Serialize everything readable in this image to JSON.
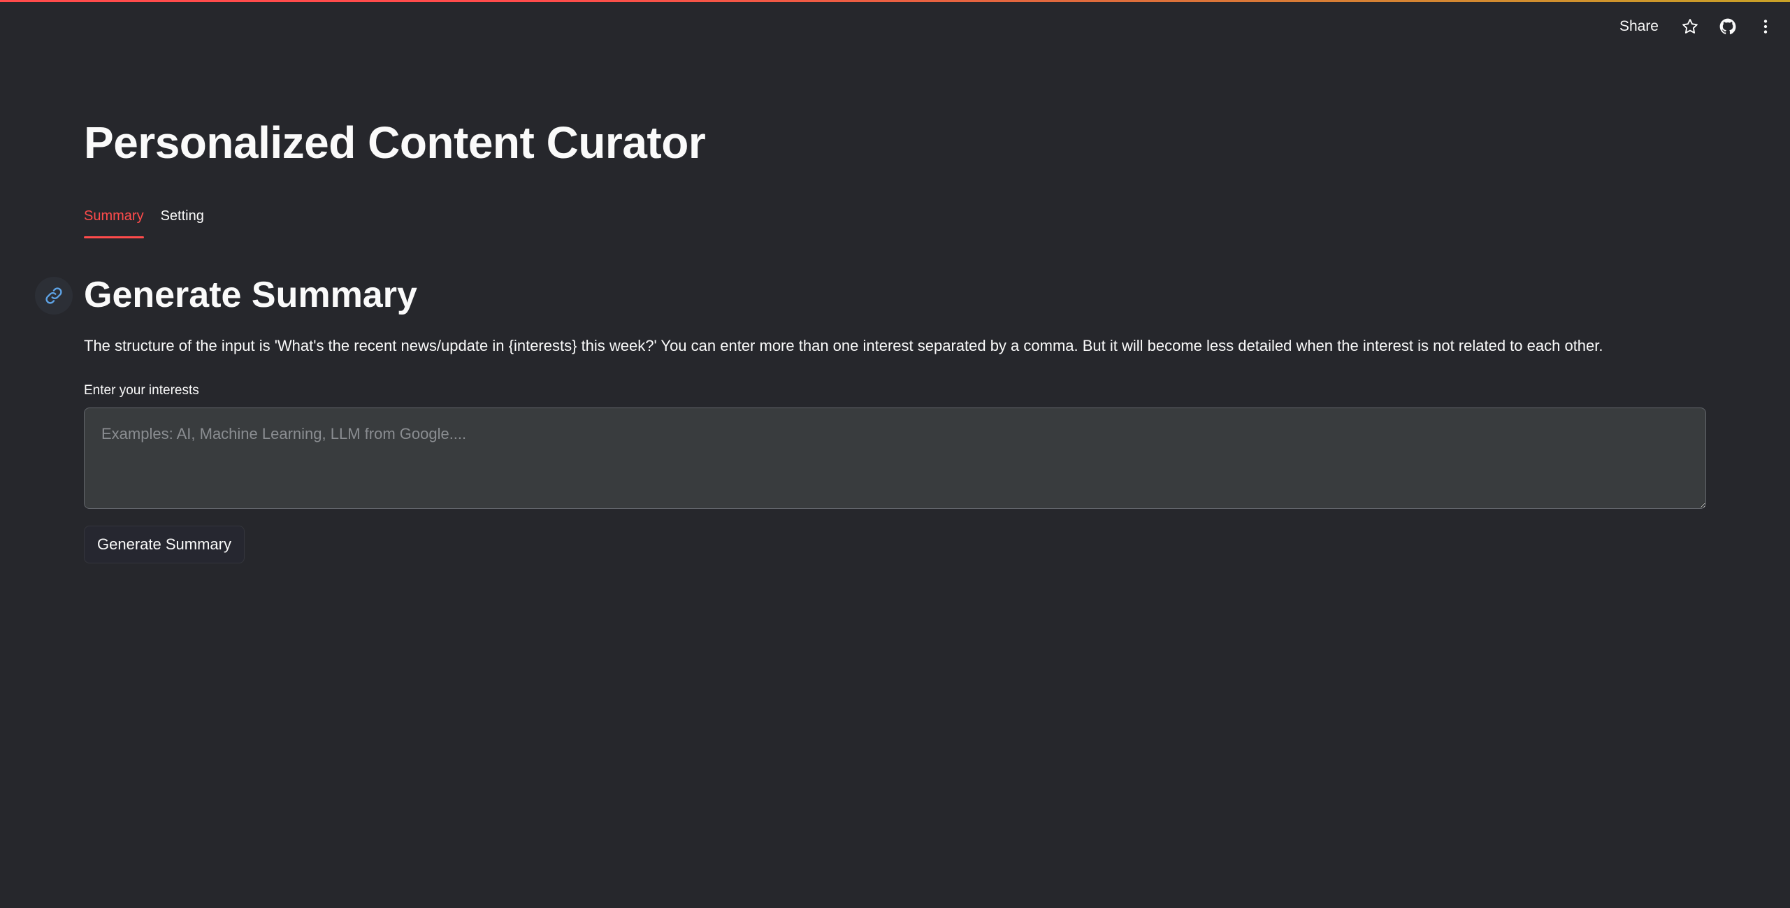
{
  "app": {
    "title": "Personalized Content Curator"
  },
  "toolbar": {
    "share_label": "Share",
    "icons": [
      "star-icon",
      "github-icon",
      "kebab-menu-icon"
    ]
  },
  "tabs": [
    {
      "label": "Summary",
      "active": true
    },
    {
      "label": "Setting",
      "active": false
    }
  ],
  "section": {
    "heading": "Generate Summary",
    "anchor_icon": "link-icon",
    "description": "The structure of the input is 'What's the recent news/update in {interests} this week?' You can enter more than one interest separated by a comma. But it will become less detailed when the interest is not related to each other."
  },
  "interests_input": {
    "label": "Enter your interests",
    "value": "",
    "placeholder": "Examples: AI, Machine Learning, LLM from Google...."
  },
  "generate_button": {
    "label": "Generate Summary"
  },
  "colors": {
    "background": "#26272c",
    "accent": "#ff4b4b",
    "text": "#fafafa",
    "input_background": "#393c3e",
    "link_icon": "#5ea3e6"
  }
}
